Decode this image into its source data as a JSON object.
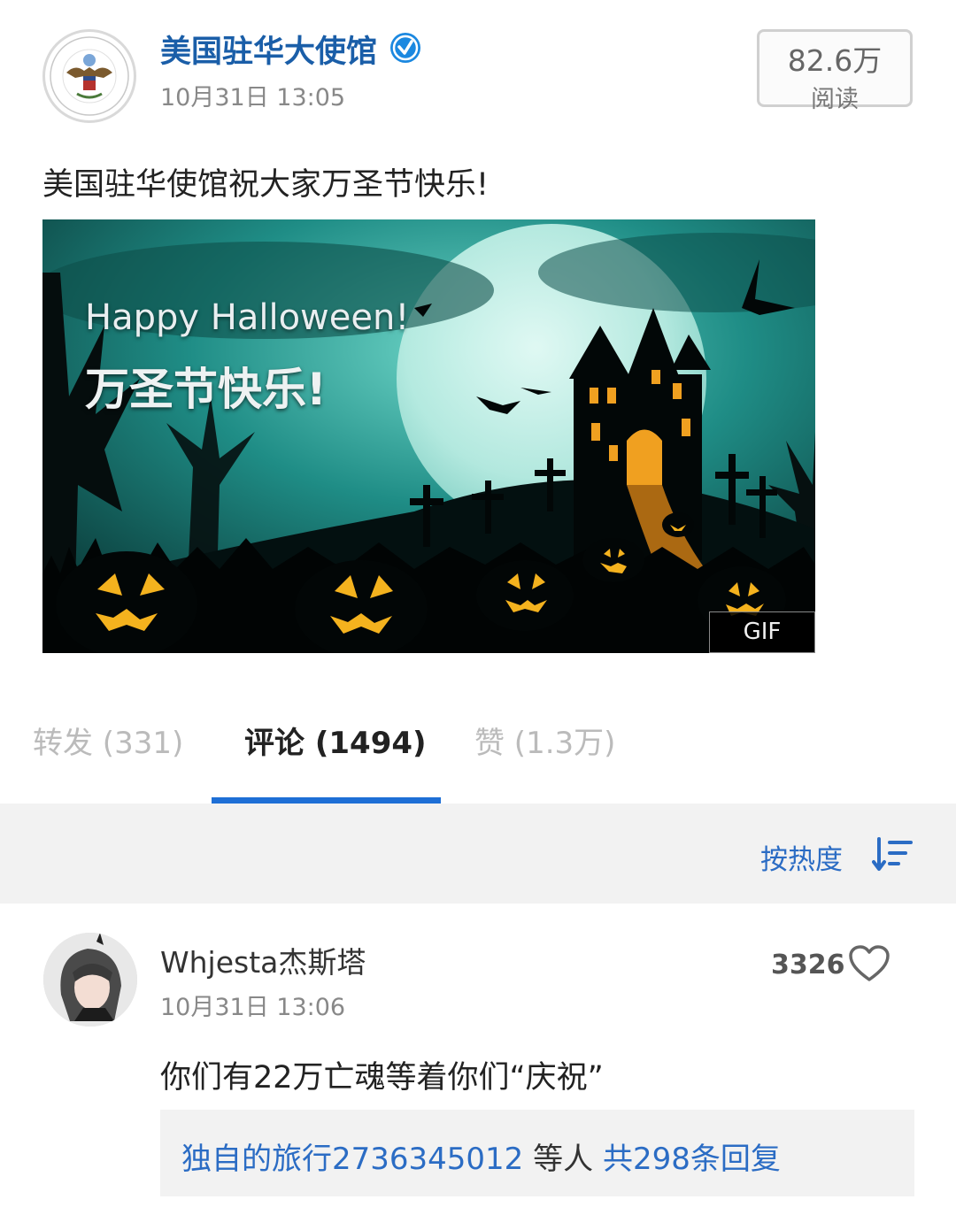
{
  "post": {
    "account_name": "美国驻华大使馆",
    "time": "10月31日 13:05",
    "read_count": "82.6万",
    "read_label": "阅读",
    "text": "美国驻华使馆祝大家万圣节快乐!",
    "image": {
      "title_en": "Happy Halloween!",
      "title_zh": "万圣节快乐!",
      "badge": "GIF"
    }
  },
  "tabs": [
    {
      "label": "转发 (331)",
      "active": false
    },
    {
      "label": "评论 (1494)",
      "active": true
    },
    {
      "label": "赞 (1.3万)",
      "active": false
    }
  ],
  "sort": {
    "label": "按热度"
  },
  "comment": {
    "user": "Whjesta杰斯塔",
    "time": "10月31日 13:06",
    "likes": "3326",
    "text": "你们有22万亡魂等着你们“庆祝”",
    "reply_users": "独自的旅行2736345012",
    "reply_mid": " 等人 ",
    "reply_total": "共298条回复"
  },
  "colors": {
    "accent_blue": "#1e6fd6",
    "link_blue": "#2b6cc4",
    "verified_blue": "#1b88e0"
  },
  "icons": [
    "verified-icon",
    "sort-icon",
    "heart-icon"
  ]
}
